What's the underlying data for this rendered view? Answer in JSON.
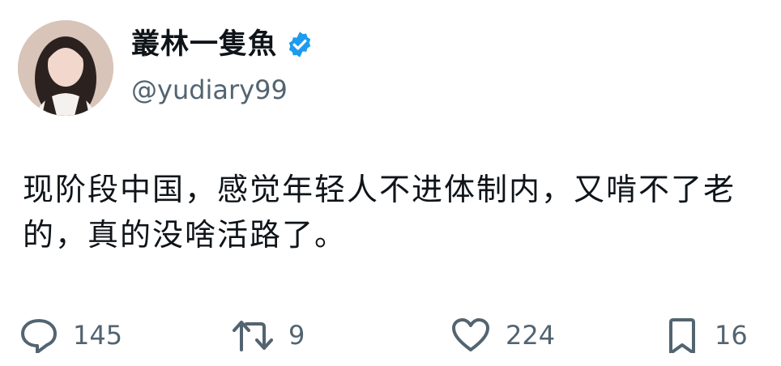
{
  "user": {
    "display_name": "叢林一隻魚",
    "handle": "@yudiary99",
    "verified": true,
    "verified_color": "#1d9bf0"
  },
  "tweet": {
    "text": "现阶段中国，感觉年轻人不进体制内，又啃不了老的，真的没啥活路了。"
  },
  "actions": {
    "reply": {
      "icon": "reply-icon",
      "count": "145"
    },
    "retweet": {
      "icon": "retweet-icon",
      "count": "9"
    },
    "like": {
      "icon": "heart-icon",
      "count": "224"
    },
    "bookmark": {
      "icon": "bookmark-icon",
      "count": "16"
    }
  },
  "colors": {
    "text": "#0f1419",
    "secondary": "#536471",
    "accent": "#1d9bf0"
  }
}
